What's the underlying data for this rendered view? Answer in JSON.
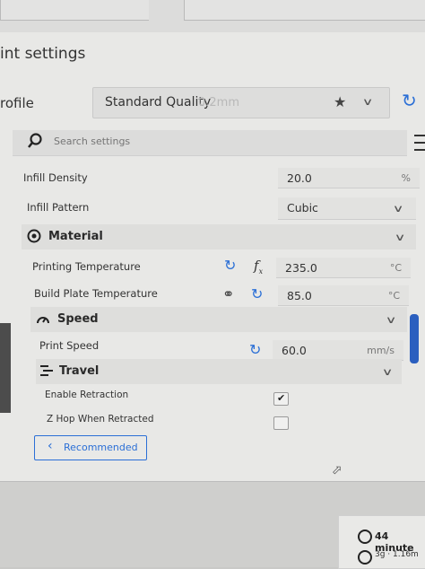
{
  "window": {
    "title": "int settings"
  },
  "profile": {
    "label": "rofile",
    "name": "Standard Quality",
    "layer": "0.2mm"
  },
  "search": {
    "placeholder": "Search settings"
  },
  "infill": {
    "density_label": "Infill Density",
    "density_value": "20.0",
    "density_unit": "%",
    "pattern_label": "Infill Pattern",
    "pattern_value": "Cubic"
  },
  "material": {
    "section_label": "Material",
    "printing_temp_label": "Printing Temperature",
    "printing_temp_value": "235.0",
    "printing_temp_unit": "°C",
    "bed_temp_label": "Build Plate Temperature",
    "bed_temp_value": "85.0",
    "bed_temp_unit": "°C"
  },
  "speed": {
    "section_label": "Speed",
    "print_speed_label": "Print Speed",
    "print_speed_value": "60.0",
    "print_speed_unit": "mm/s"
  },
  "travel": {
    "section_label": "Travel",
    "retraction_label": "Enable Retraction",
    "retraction_checked": true,
    "zhop_label": "Z Hop When Retracted",
    "zhop_checked": false
  },
  "footer": {
    "recommended_label": "Recommended"
  },
  "stats": {
    "time": "44 minute",
    "material": "3g · 1.16m"
  },
  "colors": {
    "accent": "#2b6fd6",
    "panel": "#e8e8e6"
  }
}
